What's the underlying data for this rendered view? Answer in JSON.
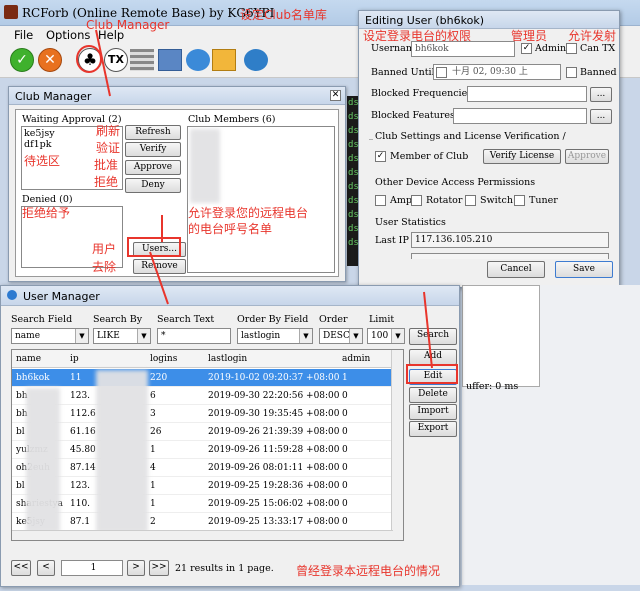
{
  "main": {
    "title": "RCForb (Online Remote Base) by KG6YPI",
    "menu": [
      "File",
      "Options",
      "Help"
    ]
  },
  "club_manager": {
    "title": "Club Manager",
    "waiting_label": "Waiting Approval (2)",
    "waiting": [
      "ke5jsy",
      "df1pk"
    ],
    "denied_label": "Denied (0)",
    "members_label": "Club Members (6)",
    "buttons": {
      "refresh": "Refresh",
      "verify": "Verify",
      "approve": "Approve",
      "deny": "Deny",
      "users": "Users...",
      "remove": "Remove"
    }
  },
  "console": {
    "lines": [
      "ds",
      "ds",
      "ds",
      "ds",
      "ds",
      "ds",
      "ds",
      "ds",
      "ds",
      "ds",
      "ds"
    ]
  },
  "edit_user": {
    "title": "Editing User (bh6kok)",
    "username_label": "Username",
    "username": "bh6kok",
    "admin_label": "Admin",
    "cantx_label": "Can TX",
    "banned_until_label": "Banned Until",
    "banned_date": "十月  02, 09:30 上",
    "banned_label": "Banned",
    "blocked_freq_label": "Blocked Frequencies",
    "blocked_feat_label": "Blocked Features",
    "browse": "...",
    "club_section": "Club Settings and License Verification /",
    "member_label": "Member of Club",
    "verify_license": "Verify License",
    "approve": "Approve",
    "device_section": "Other Device Access Permissions",
    "perm_amp": "Amp",
    "perm_rotator": "Rotator",
    "perm_switch": "Switch",
    "perm_tuner": "Tuner",
    "stats_section": "User Statistics",
    "last_ip_label": "Last IP",
    "last_ip": "117.136.105.210",
    "cancel": "Cancel",
    "save": "Save"
  },
  "user_manager": {
    "title": "User Manager",
    "search_field_label": "Search Field",
    "search_field": "name",
    "search_by_label": "Search By",
    "search_by": "LIKE",
    "search_text_label": "Search Text",
    "search_text": "*",
    "order_by_label": "Order By Field",
    "order_by": "lastlogin",
    "order_label": "Order",
    "order": "DESC",
    "limit_label": "Limit",
    "limit": "100",
    "columns": [
      "name",
      "ip",
      "logins",
      "lastlogin",
      "admin"
    ],
    "rows": [
      [
        "bh6kok",
        "11",
        "220",
        "2019-10-02 09:20:37 +08:00",
        "1"
      ],
      [
        "bh",
        "123.",
        "6",
        "2019-09-30 22:20:56 +08:00",
        "0"
      ],
      [
        "bh",
        "112.6",
        "3",
        "2019-09-30 19:35:45 +08:00",
        "0"
      ],
      [
        "bl",
        "61.16",
        "26",
        "2019-09-26 21:39:39 +08:00",
        "0"
      ],
      [
        "yulzmz",
        "45.80",
        "1",
        "2019-09-26 11:59:28 +08:00",
        "0"
      ],
      [
        "oh2euh",
        "87.14",
        "4",
        "2019-09-26 08:01:11 +08:00",
        "0"
      ],
      [
        "bl",
        "123.",
        "1",
        "2019-09-25 19:28:36 +08:00",
        "0"
      ],
      [
        "shariestya",
        "110.",
        "1",
        "2019-09-25 15:06:02 +08:00",
        "0"
      ],
      [
        "ke5jsy",
        "87.1",
        "2",
        "2019-09-25 13:33:17 +08:00",
        "0"
      ]
    ],
    "buttons": {
      "search": "Search",
      "add": "Add",
      "edit": "Edit",
      "delete": "Delete",
      "import": "Import",
      "export": "Export"
    },
    "page": "1",
    "results": "21 results in 1 page.",
    "nav_first": "<<",
    "nav_prev": "<",
    "nav_next": ">",
    "nav_last": ">>"
  },
  "status": {
    "buffer": "uffer: 0 ms"
  },
  "annotations": {
    "club_manager": "Club Manager",
    "set_club_db": "设定Club名单库",
    "set_rights": "设定登录电台的权限",
    "admin": "管理员",
    "allow_tx": "允许发射",
    "refresh": "刷新",
    "verify": "验证",
    "approve": "批准",
    "deny": "拒绝",
    "pending": "待选区",
    "denied": "拒绝给予",
    "allowed": "允许登录您的远程电台",
    "callsigns": "的电台呼号名单",
    "user": "用户",
    "remove": "去除",
    "history": "曾经登录本远程电台的情况"
  },
  "colors": {
    "annotation": "#e8352c",
    "selection": "#3d8ee8",
    "title_bar": "#c5d9ef"
  }
}
